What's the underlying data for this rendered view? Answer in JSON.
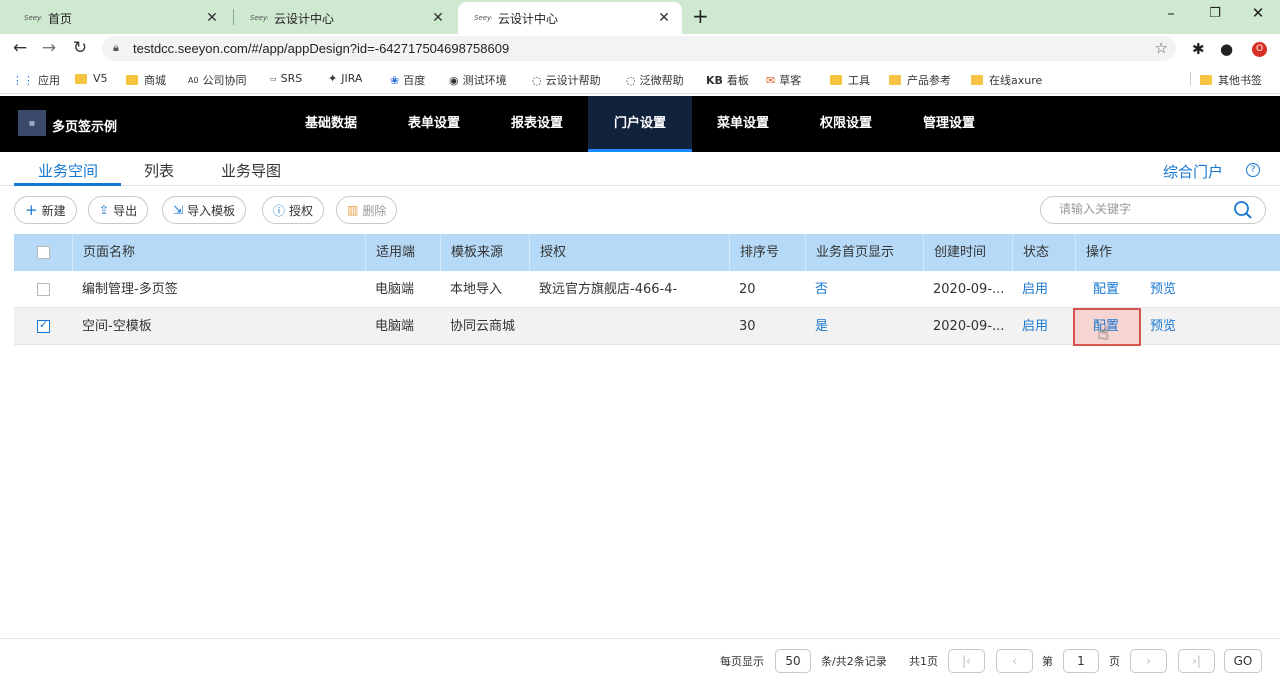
{
  "browser": {
    "tabs": [
      {
        "title": "首页",
        "favicon": "seeyon-logo",
        "active": false
      },
      {
        "title": "云设计中心",
        "favicon": "seeyon-logo",
        "active": false
      },
      {
        "title": "云设计中心",
        "favicon": "seeyon-logo",
        "active": true
      }
    ],
    "url": "testdcc.seeyon.com/#/app/appDesign?id=-642717504698758609",
    "bookmarks": [
      "应用",
      "V5",
      "商城",
      "公司协同",
      "SRS",
      "JIRA",
      "百度",
      "测试环境",
      "云设计帮助",
      "泛微帮助",
      "看板",
      "草客",
      "工具",
      "产品参考",
      "在线axure"
    ],
    "bookmark_prefixes": {
      "kb": "KB",
      "ad": "A0"
    },
    "other_bookmarks": "其他书签"
  },
  "app": {
    "name": "多页签示例",
    "nav": [
      "基础数据",
      "表单设置",
      "报表设置",
      "门户设置",
      "菜单设置",
      "权限设置",
      "管理设置"
    ],
    "active_nav": "门户设置"
  },
  "subtabs": [
    "业务空间",
    "列表",
    "业务导图"
  ],
  "portal_link": "综合门户",
  "help": "?",
  "toolbar": {
    "new": "新建",
    "export": "导出",
    "import_template": "导入模板",
    "authorize": "授权",
    "delete": "删除",
    "search_placeholder": "请输入关键字"
  },
  "table": {
    "columns": [
      "页面名称",
      "适用端",
      "模板来源",
      "授权",
      "排序号",
      "业务首页显示",
      "创建时间",
      "状态",
      "操作"
    ],
    "rows": [
      {
        "checked": false,
        "name": "编制管理-多页签",
        "platform": "电脑端",
        "source": "本地导入",
        "auth": "致远官方旗舰店-466-4-",
        "order": "20",
        "homepage": "否",
        "created": "2020-09-...",
        "status": "启用",
        "op1": "配置",
        "op2": "预览"
      },
      {
        "checked": true,
        "name": "空间-空模板",
        "platform": "电脑端",
        "source": "协同云商城",
        "auth": "",
        "order": "30",
        "homepage": "是",
        "created": "2020-09-...",
        "status": "启用",
        "op1": "配置",
        "op2": "预览"
      }
    ]
  },
  "pagination": {
    "per_page_label": "每页显示",
    "per_page": "50",
    "records": "条/共2条记录",
    "total_pages": "共1页",
    "page_label_pre": "第",
    "page": "1",
    "page_label_post": "页",
    "go": "GO"
  },
  "colors": {
    "accent": "#1677d2",
    "header_bg": "#000000",
    "table_header": "#b5d9f6",
    "highlight": "#d9534f"
  }
}
